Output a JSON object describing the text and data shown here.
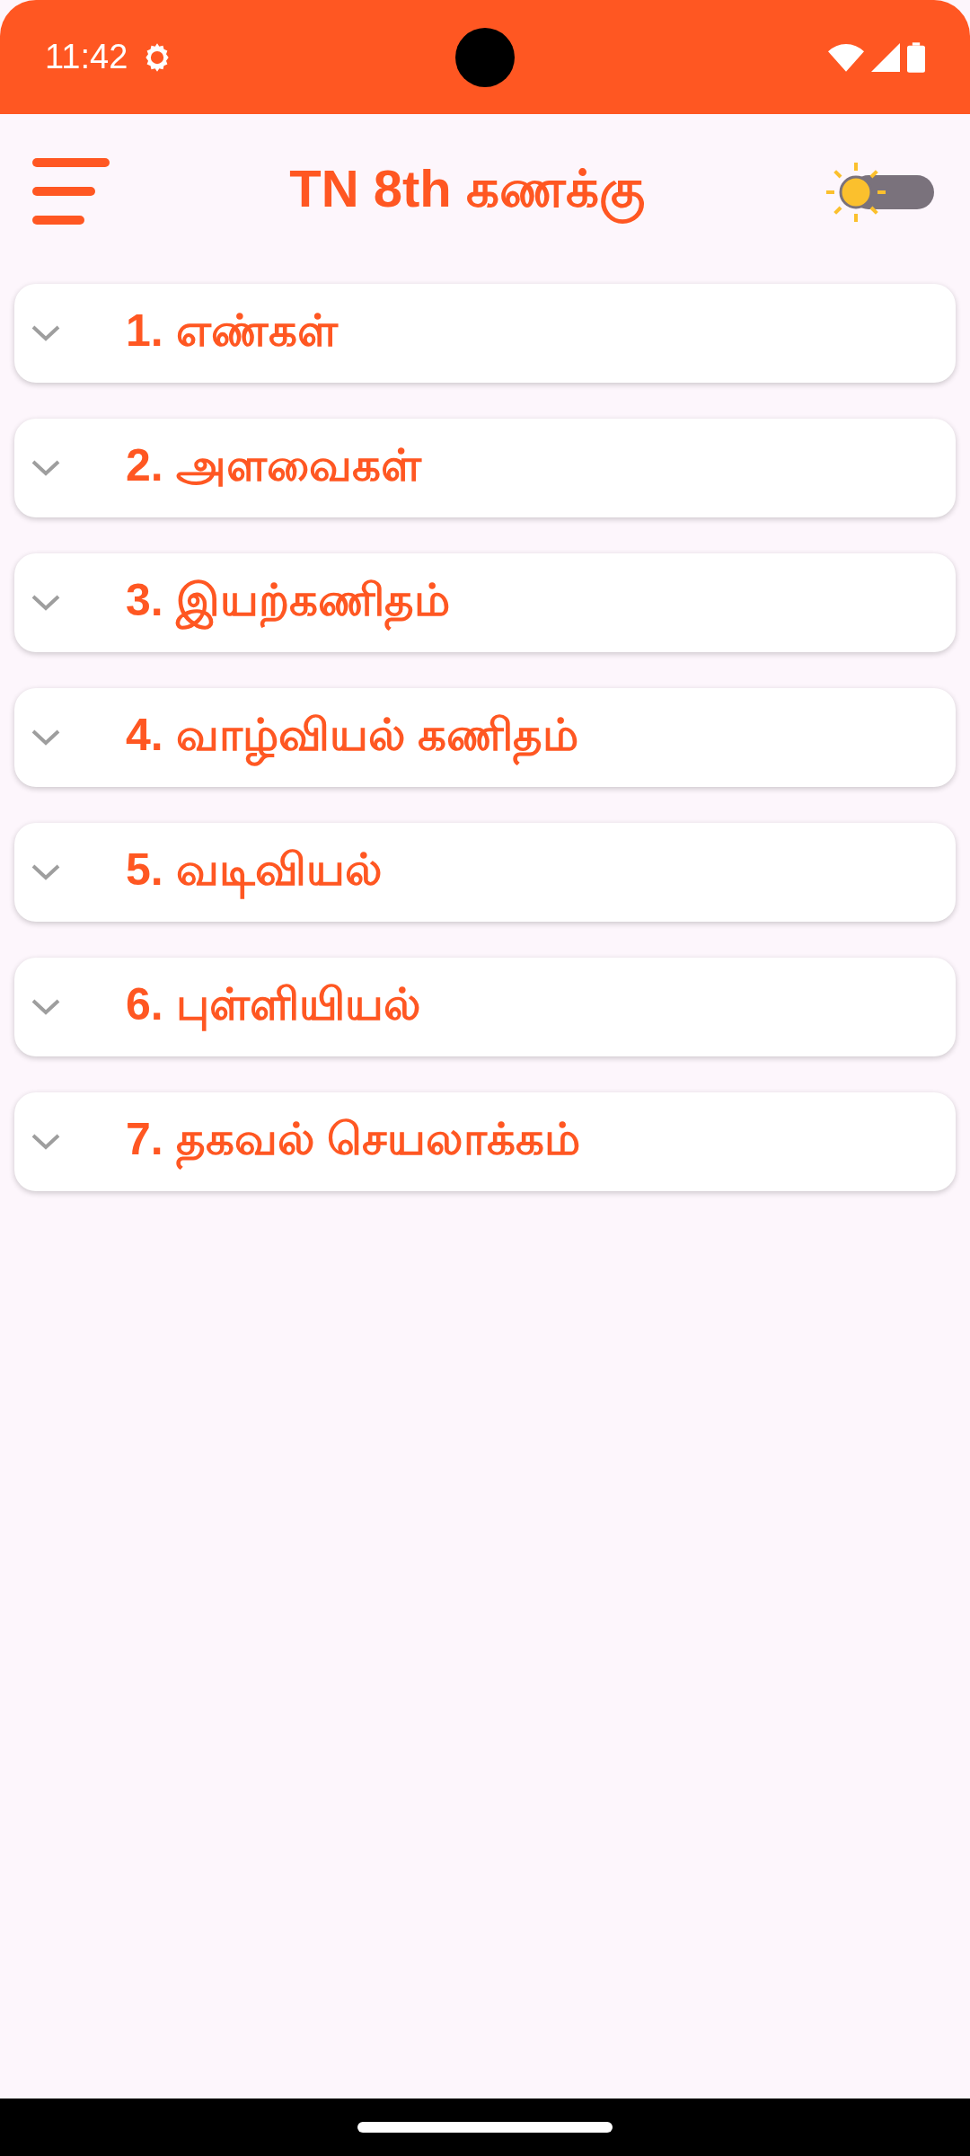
{
  "status_bar": {
    "time": "11:42"
  },
  "app_bar": {
    "title": "TN 8th கணக்கு",
    "dark_mode": false
  },
  "chapters": [
    {
      "title": "1. எண்கள்",
      "expanded": false
    },
    {
      "title": "2. அளவைகள்",
      "expanded": false
    },
    {
      "title": "3. இயற்கணிதம்",
      "expanded": false
    },
    {
      "title": "4. வாழ்வியல் கணிதம்",
      "expanded": false
    },
    {
      "title": "5. வடிவியல்",
      "expanded": false
    },
    {
      "title": "6. புள்ளியியல்",
      "expanded": false
    },
    {
      "title": "7. தகவல் செயலாக்கம்",
      "expanded": false
    }
  ]
}
